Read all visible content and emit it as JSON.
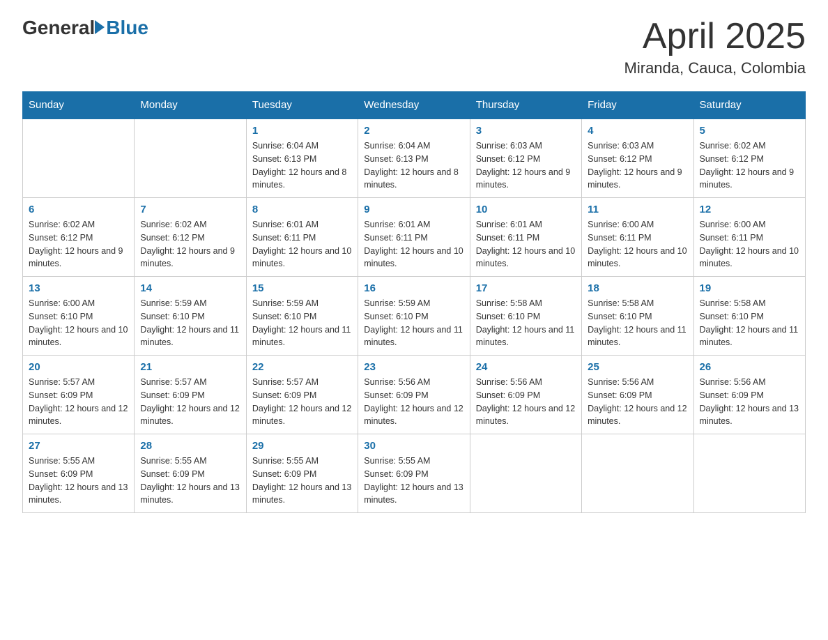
{
  "header": {
    "logo_general": "General",
    "logo_blue": "Blue",
    "title": "April 2025",
    "subtitle": "Miranda, Cauca, Colombia"
  },
  "days_of_week": [
    "Sunday",
    "Monday",
    "Tuesday",
    "Wednesday",
    "Thursday",
    "Friday",
    "Saturday"
  ],
  "weeks": [
    [
      {
        "day": "",
        "sunrise": "",
        "sunset": "",
        "daylight": ""
      },
      {
        "day": "",
        "sunrise": "",
        "sunset": "",
        "daylight": ""
      },
      {
        "day": "1",
        "sunrise": "Sunrise: 6:04 AM",
        "sunset": "Sunset: 6:13 PM",
        "daylight": "Daylight: 12 hours and 8 minutes."
      },
      {
        "day": "2",
        "sunrise": "Sunrise: 6:04 AM",
        "sunset": "Sunset: 6:13 PM",
        "daylight": "Daylight: 12 hours and 8 minutes."
      },
      {
        "day": "3",
        "sunrise": "Sunrise: 6:03 AM",
        "sunset": "Sunset: 6:12 PM",
        "daylight": "Daylight: 12 hours and 9 minutes."
      },
      {
        "day": "4",
        "sunrise": "Sunrise: 6:03 AM",
        "sunset": "Sunset: 6:12 PM",
        "daylight": "Daylight: 12 hours and 9 minutes."
      },
      {
        "day": "5",
        "sunrise": "Sunrise: 6:02 AM",
        "sunset": "Sunset: 6:12 PM",
        "daylight": "Daylight: 12 hours and 9 minutes."
      }
    ],
    [
      {
        "day": "6",
        "sunrise": "Sunrise: 6:02 AM",
        "sunset": "Sunset: 6:12 PM",
        "daylight": "Daylight: 12 hours and 9 minutes."
      },
      {
        "day": "7",
        "sunrise": "Sunrise: 6:02 AM",
        "sunset": "Sunset: 6:12 PM",
        "daylight": "Daylight: 12 hours and 9 minutes."
      },
      {
        "day": "8",
        "sunrise": "Sunrise: 6:01 AM",
        "sunset": "Sunset: 6:11 PM",
        "daylight": "Daylight: 12 hours and 10 minutes."
      },
      {
        "day": "9",
        "sunrise": "Sunrise: 6:01 AM",
        "sunset": "Sunset: 6:11 PM",
        "daylight": "Daylight: 12 hours and 10 minutes."
      },
      {
        "day": "10",
        "sunrise": "Sunrise: 6:01 AM",
        "sunset": "Sunset: 6:11 PM",
        "daylight": "Daylight: 12 hours and 10 minutes."
      },
      {
        "day": "11",
        "sunrise": "Sunrise: 6:00 AM",
        "sunset": "Sunset: 6:11 PM",
        "daylight": "Daylight: 12 hours and 10 minutes."
      },
      {
        "day": "12",
        "sunrise": "Sunrise: 6:00 AM",
        "sunset": "Sunset: 6:11 PM",
        "daylight": "Daylight: 12 hours and 10 minutes."
      }
    ],
    [
      {
        "day": "13",
        "sunrise": "Sunrise: 6:00 AM",
        "sunset": "Sunset: 6:10 PM",
        "daylight": "Daylight: 12 hours and 10 minutes."
      },
      {
        "day": "14",
        "sunrise": "Sunrise: 5:59 AM",
        "sunset": "Sunset: 6:10 PM",
        "daylight": "Daylight: 12 hours and 11 minutes."
      },
      {
        "day": "15",
        "sunrise": "Sunrise: 5:59 AM",
        "sunset": "Sunset: 6:10 PM",
        "daylight": "Daylight: 12 hours and 11 minutes."
      },
      {
        "day": "16",
        "sunrise": "Sunrise: 5:59 AM",
        "sunset": "Sunset: 6:10 PM",
        "daylight": "Daylight: 12 hours and 11 minutes."
      },
      {
        "day": "17",
        "sunrise": "Sunrise: 5:58 AM",
        "sunset": "Sunset: 6:10 PM",
        "daylight": "Daylight: 12 hours and 11 minutes."
      },
      {
        "day": "18",
        "sunrise": "Sunrise: 5:58 AM",
        "sunset": "Sunset: 6:10 PM",
        "daylight": "Daylight: 12 hours and 11 minutes."
      },
      {
        "day": "19",
        "sunrise": "Sunrise: 5:58 AM",
        "sunset": "Sunset: 6:10 PM",
        "daylight": "Daylight: 12 hours and 11 minutes."
      }
    ],
    [
      {
        "day": "20",
        "sunrise": "Sunrise: 5:57 AM",
        "sunset": "Sunset: 6:09 PM",
        "daylight": "Daylight: 12 hours and 12 minutes."
      },
      {
        "day": "21",
        "sunrise": "Sunrise: 5:57 AM",
        "sunset": "Sunset: 6:09 PM",
        "daylight": "Daylight: 12 hours and 12 minutes."
      },
      {
        "day": "22",
        "sunrise": "Sunrise: 5:57 AM",
        "sunset": "Sunset: 6:09 PM",
        "daylight": "Daylight: 12 hours and 12 minutes."
      },
      {
        "day": "23",
        "sunrise": "Sunrise: 5:56 AM",
        "sunset": "Sunset: 6:09 PM",
        "daylight": "Daylight: 12 hours and 12 minutes."
      },
      {
        "day": "24",
        "sunrise": "Sunrise: 5:56 AM",
        "sunset": "Sunset: 6:09 PM",
        "daylight": "Daylight: 12 hours and 12 minutes."
      },
      {
        "day": "25",
        "sunrise": "Sunrise: 5:56 AM",
        "sunset": "Sunset: 6:09 PM",
        "daylight": "Daylight: 12 hours and 12 minutes."
      },
      {
        "day": "26",
        "sunrise": "Sunrise: 5:56 AM",
        "sunset": "Sunset: 6:09 PM",
        "daylight": "Daylight: 12 hours and 13 minutes."
      }
    ],
    [
      {
        "day": "27",
        "sunrise": "Sunrise: 5:55 AM",
        "sunset": "Sunset: 6:09 PM",
        "daylight": "Daylight: 12 hours and 13 minutes."
      },
      {
        "day": "28",
        "sunrise": "Sunrise: 5:55 AM",
        "sunset": "Sunset: 6:09 PM",
        "daylight": "Daylight: 12 hours and 13 minutes."
      },
      {
        "day": "29",
        "sunrise": "Sunrise: 5:55 AM",
        "sunset": "Sunset: 6:09 PM",
        "daylight": "Daylight: 12 hours and 13 minutes."
      },
      {
        "day": "30",
        "sunrise": "Sunrise: 5:55 AM",
        "sunset": "Sunset: 6:09 PM",
        "daylight": "Daylight: 12 hours and 13 minutes."
      },
      {
        "day": "",
        "sunrise": "",
        "sunset": "",
        "daylight": ""
      },
      {
        "day": "",
        "sunrise": "",
        "sunset": "",
        "daylight": ""
      },
      {
        "day": "",
        "sunrise": "",
        "sunset": "",
        "daylight": ""
      }
    ]
  ]
}
